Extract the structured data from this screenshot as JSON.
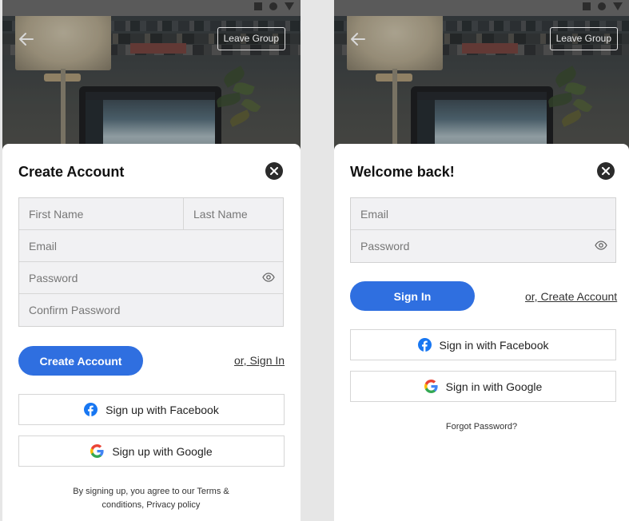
{
  "colors": {
    "primary": "#2f6fe0",
    "sheet": "#ffffff",
    "field_bg": "#f1f1f3",
    "facebook": "#1877f2"
  },
  "icons": {
    "back": "arrow-left-icon",
    "close": "close-circle-icon",
    "eye": "eye-icon",
    "facebook": "facebook-icon",
    "google": "google-icon"
  },
  "create_screen": {
    "leave_group": "Leave Group",
    "title": "Create Account",
    "fields": {
      "first_name_placeholder": "First Name",
      "last_name_placeholder": "Last Name",
      "email_placeholder": "Email",
      "password_placeholder": "Password",
      "confirm_password_placeholder": "Confirm Password"
    },
    "primary_button": "Create Account",
    "alt_link": "or, Sign In",
    "facebook_button": "Sign up with Facebook",
    "google_button": "Sign up with Google",
    "terms_line1": "By signing up, you agree to our Terms &",
    "terms_line2": "conditions, Privacy policy"
  },
  "signin_screen": {
    "leave_group": "Leave Group",
    "title": "Welcome back!",
    "fields": {
      "email_placeholder": "Email",
      "password_placeholder": "Password"
    },
    "primary_button": "Sign In",
    "alt_link": "or, Create Account",
    "facebook_button": "Sign in with Facebook",
    "google_button": "Sign in with Google",
    "forgot": "Forgot Password?"
  }
}
